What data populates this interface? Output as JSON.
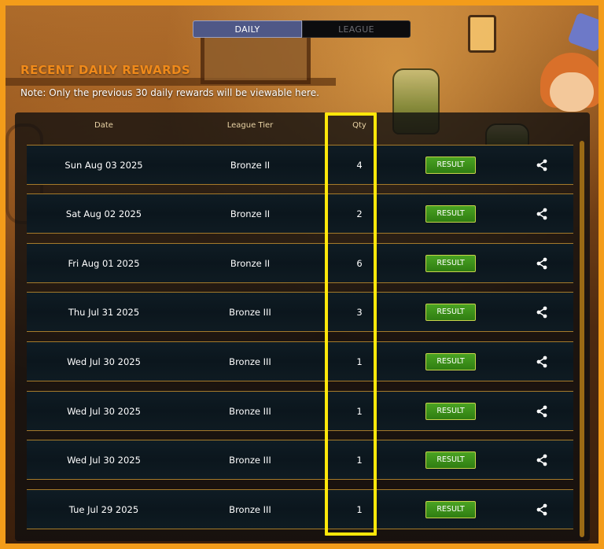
{
  "tabs": {
    "daily": "DAILY",
    "league": "LEAGUE",
    "active": "daily"
  },
  "title": "RECENT DAILY REWARDS",
  "note": "Note: Only the previous 30 daily rewards will be viewable here.",
  "columns": {
    "date": "Date",
    "league_tier": "League Tier",
    "qty": "Qty"
  },
  "rows": [
    {
      "date": "Sun Aug 03 2025",
      "tier": "Bronze II",
      "qty": "4",
      "result": "RESULT"
    },
    {
      "date": "Sat Aug 02 2025",
      "tier": "Bronze II",
      "qty": "2",
      "result": "RESULT"
    },
    {
      "date": "Fri Aug 01 2025",
      "tier": "Bronze II",
      "qty": "6",
      "result": "RESULT"
    },
    {
      "date": "Thu Jul 31 2025",
      "tier": "Bronze III",
      "qty": "3",
      "result": "RESULT"
    },
    {
      "date": "Wed Jul 30 2025",
      "tier": "Bronze III",
      "qty": "1",
      "result": "RESULT"
    },
    {
      "date": "Wed Jul 30 2025",
      "tier": "Bronze III",
      "qty": "1",
      "result": "RESULT"
    },
    {
      "date": "Wed Jul 30 2025",
      "tier": "Bronze III",
      "qty": "1",
      "result": "RESULT"
    },
    {
      "date": "Tue Jul 29 2025",
      "tier": "Bronze III",
      "qty": "1",
      "result": "RESULT"
    }
  ],
  "icons": {
    "share": "share-icon"
  },
  "colors": {
    "accent_orange": "#f08a1a",
    "result_green": "#3a8f18",
    "highlight_yellow": "#ffe70a",
    "tab_active": "#4f5887"
  }
}
